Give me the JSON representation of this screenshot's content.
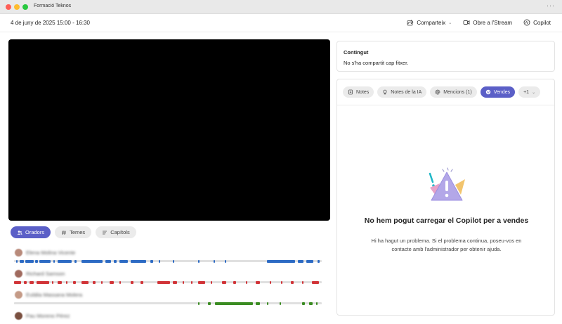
{
  "window": {
    "title": "Formació Teknos",
    "more_label": "···"
  },
  "header": {
    "meeting_time": "4 de juny de 2025 15:00 - 16:30",
    "share_label": "Comparteix",
    "open_stream_label": "Obre a l'Stream",
    "copilot_label": "Copilot"
  },
  "lower_tabs": {
    "speakers": "Oradors",
    "topics": "Temes",
    "chapters": "Capítols"
  },
  "speakers": [
    {
      "name": "Elena Molina Vicente",
      "color": "#2d6bc4"
    },
    {
      "name": "Richard Samson",
      "color": "#d13438"
    },
    {
      "name": "Eulàlia Massana Molera",
      "color": "#3b8c22"
    },
    {
      "name": "Pau Moreno Pérez",
      "color": "#8a5a44"
    }
  ],
  "content_card": {
    "title": "Contingut",
    "text": "No s'ha compartit cap fitxer."
  },
  "notes_tabs": {
    "notes": "Notes",
    "ai_notes": "Notes de la IA",
    "mentions": "Mencions (1)",
    "sales": "Vendes",
    "more": "+1"
  },
  "empty_state": {
    "title": "No hem pogut carregar el Copilot per a vendes",
    "message": "Hi ha hagut un problema. Si el problema continua, poseu-vos en contacte amb l'administrador per obtenir ajuda."
  },
  "colors": {
    "accent": "#5b5fc7"
  }
}
